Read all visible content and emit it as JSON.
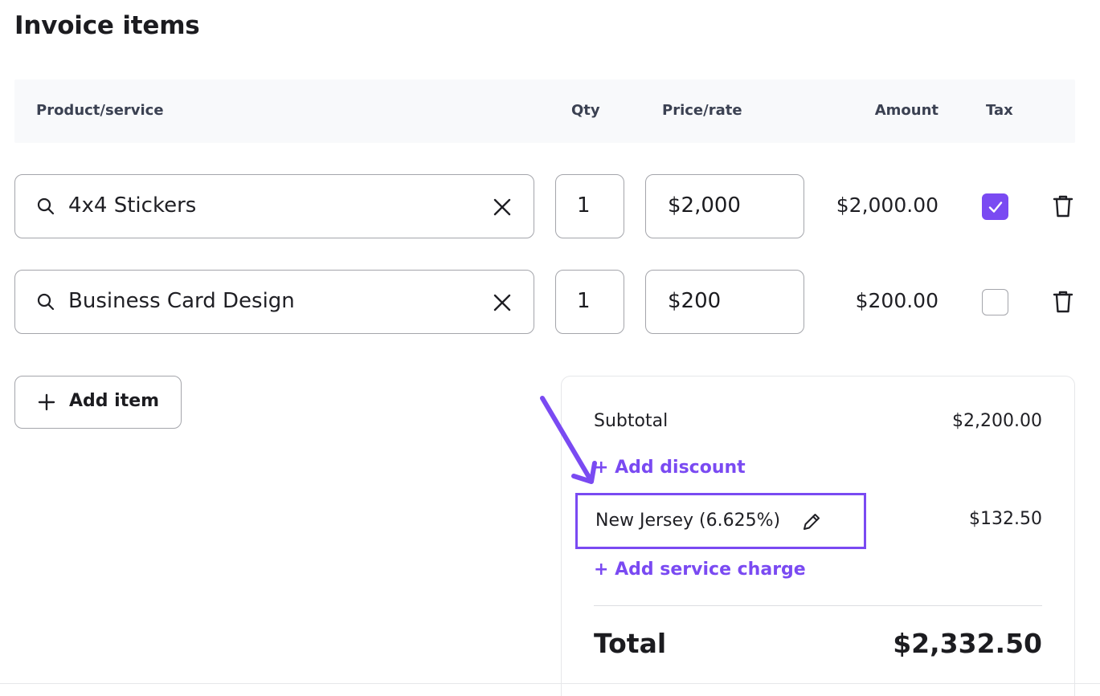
{
  "page": {
    "title": "Invoice items"
  },
  "table": {
    "headers": {
      "product": "Product/service",
      "qty": "Qty",
      "price": "Price/rate",
      "amount": "Amount",
      "tax": "Tax"
    },
    "rows": [
      {
        "product": "4x4 Stickers",
        "qty": "1",
        "price": "$2,000",
        "amount": "$2,000.00",
        "taxable": true
      },
      {
        "product": "Business Card Design",
        "qty": "1",
        "price": "$200",
        "amount": "$200.00",
        "taxable": false
      }
    ]
  },
  "actions": {
    "add_item": "Add item"
  },
  "summary": {
    "subtotal_label": "Subtotal",
    "subtotal_value": "$2,200.00",
    "add_discount": "+ Add discount",
    "tax_label": "New Jersey (6.625%)",
    "tax_value": "$132.50",
    "add_service_charge": "+ Add service charge",
    "total_label": "Total",
    "total_value": "$2,332.50"
  },
  "colors": {
    "accent": "#7a4af2",
    "border": "#a4a5ab",
    "header_bg": "#f8f9fb"
  },
  "icons": {
    "search": "search-icon",
    "clear": "close-icon",
    "tax_check": "checkmark-icon",
    "delete": "trash-icon",
    "add": "plus-icon",
    "edit": "pencil-icon"
  }
}
